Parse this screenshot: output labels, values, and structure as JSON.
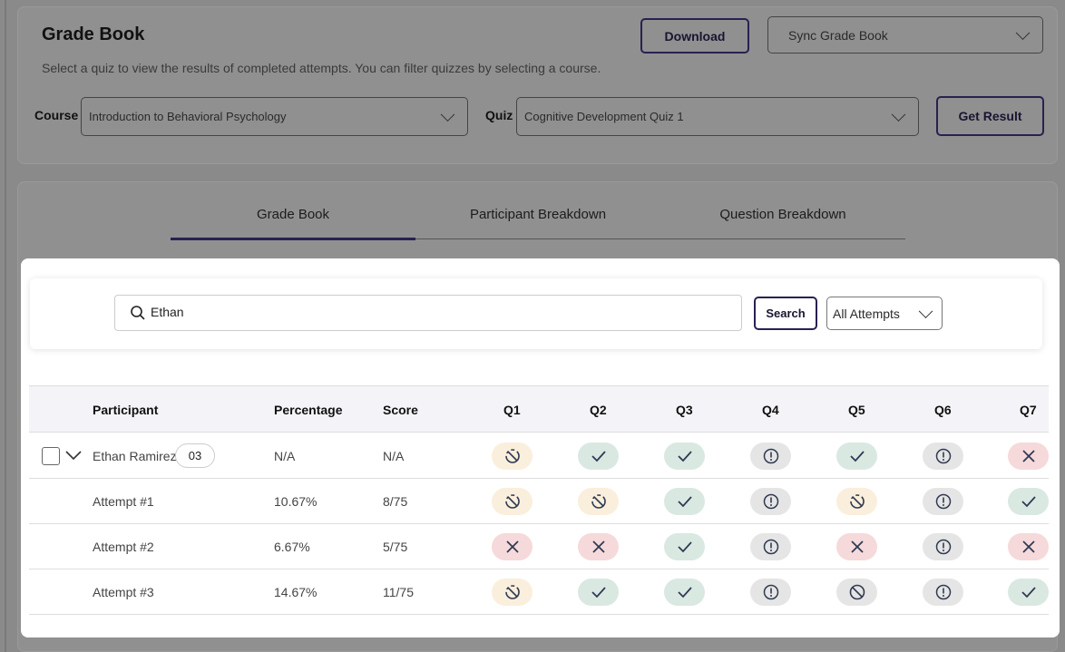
{
  "header": {
    "title": "Grade Book",
    "subtitle": "Select a quiz to view the results of completed attempts. You can filter quizzes by selecting a course.",
    "download_label": "Download",
    "sync_label": "Sync Grade Book",
    "course_label": "Course",
    "course_value": "Introduction to Behavioral Psychology",
    "quiz_label": "Quiz",
    "quiz_value": "Cognitive Development Quiz 1",
    "get_result_label": "Get Result"
  },
  "tabs": [
    {
      "label": "Grade Book",
      "active": true
    },
    {
      "label": "Participant Breakdown"
    },
    {
      "label": "Question Breakdown"
    }
  ],
  "search": {
    "value": "Ethan",
    "button": "Search",
    "filter": "All Attempts"
  },
  "table": {
    "columns": [
      "Participant",
      "Percentage",
      "Score",
      "Q1",
      "Q2",
      "Q3",
      "Q4",
      "Q5",
      "Q6",
      "Q7"
    ],
    "rows": [
      {
        "name": "Ethan Ramirez",
        "badge": "03",
        "percentage": "N/A",
        "score": "N/A",
        "q": [
          "pending",
          "correct",
          "correct",
          "unanswered",
          "correct",
          "unanswered",
          "incorrect"
        ]
      },
      {
        "name": "Attempt #1",
        "percentage": "10.67%",
        "score": "8/75",
        "q": [
          "pending",
          "pending",
          "correct",
          "unanswered",
          "pending",
          "unanswered",
          "correct"
        ]
      },
      {
        "name": "Attempt #2",
        "percentage": "6.67%",
        "score": "5/75",
        "q": [
          "incorrect",
          "incorrect",
          "correct",
          "unanswered",
          "incorrect",
          "unanswered",
          "incorrect"
        ]
      },
      {
        "name": "Attempt #3",
        "percentage": "14.67%",
        "score": "11/75",
        "q": [
          "pending",
          "correct",
          "correct",
          "unanswered",
          "skipped",
          "unanswered",
          "correct"
        ]
      }
    ]
  },
  "colors": {
    "accent": "#2a2050",
    "correct": "#dae8e2",
    "incorrect": "#f6d9da",
    "pending": "#faefdc",
    "neutral": "#e5e5e5"
  }
}
